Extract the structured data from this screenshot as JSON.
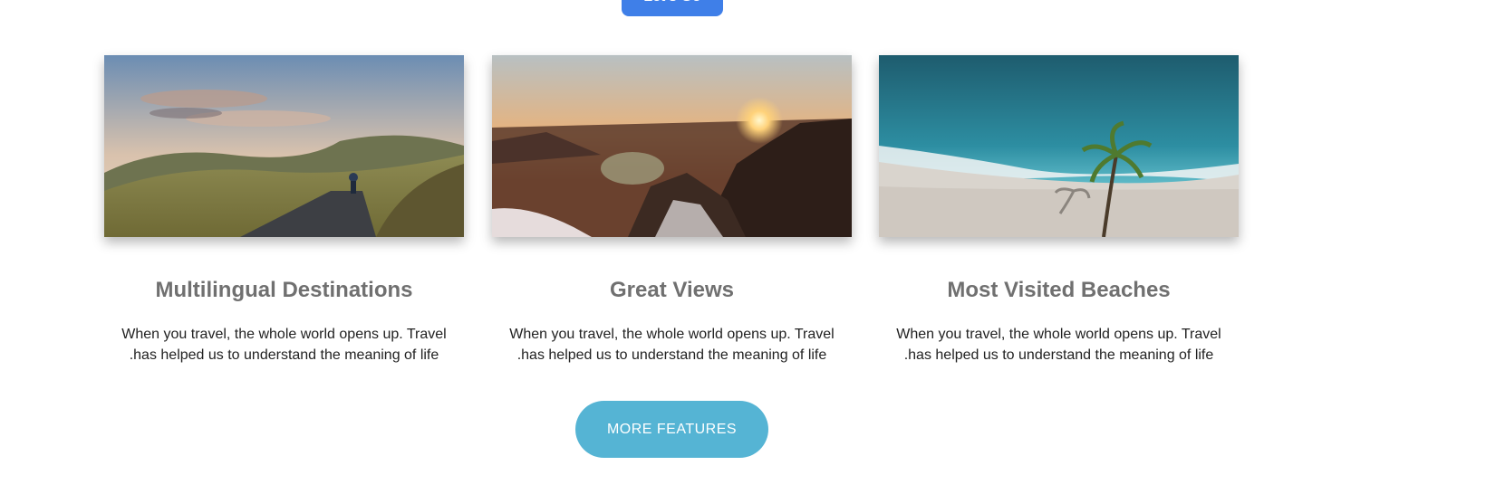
{
  "top_button": {
    "label": "Let's Go"
  },
  "cards": [
    {
      "title": "Multilingual Destinations",
      "text": "When you travel, the whole world opens up. Travel .has helped us to understand the meaning of life",
      "image": "mountain-road-cyclist"
    },
    {
      "title": "Great Views",
      "text": "When you travel, the whole world opens up. Travel .has helped us to understand the meaning of life",
      "image": "mountain-sunset"
    },
    {
      "title": "Most Visited Beaches",
      "text": "When you travel, the whole world opens up. Travel .has helped us to understand the meaning of life",
      "image": "tropical-beach-palm"
    }
  ],
  "more_features": {
    "label": "MORE FEATURES"
  },
  "colors": {
    "accent_blue": "#3f7fe8",
    "button_teal": "#55b4d4",
    "title_gray": "#707070"
  }
}
